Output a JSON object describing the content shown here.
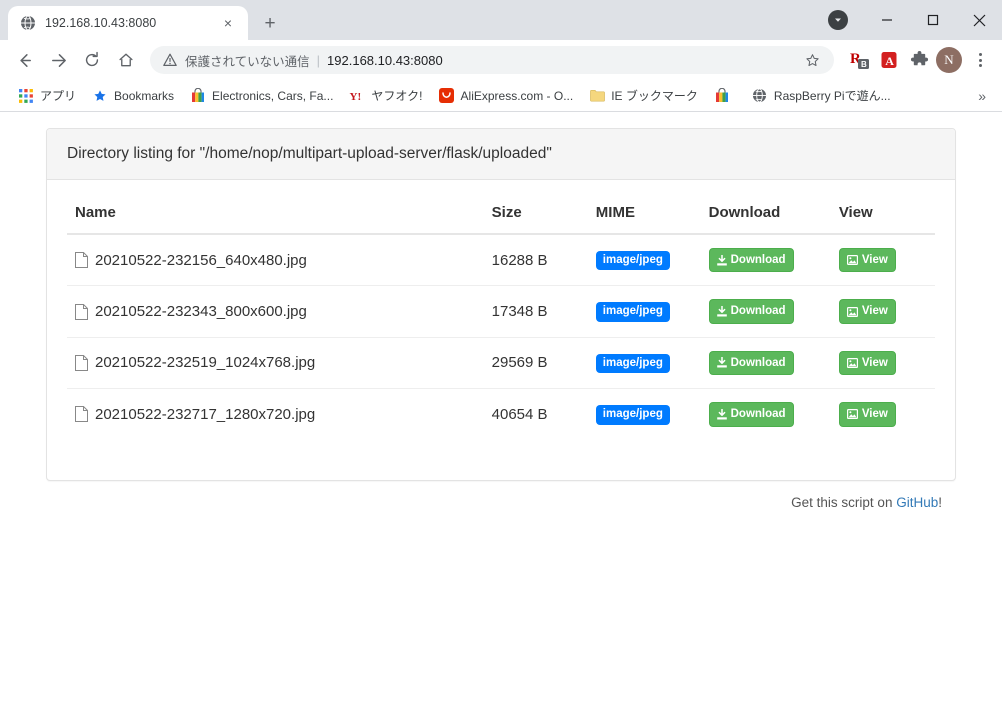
{
  "window": {
    "minimize_label": "Minimize",
    "maximize_label": "Maximize",
    "close_label": "Close",
    "download_indicator_name": "downloads-indicator"
  },
  "tab": {
    "title": "192.168.10.43:8080",
    "favicon_name": "globe-icon",
    "close_label": "×",
    "new_tab_label": "+"
  },
  "toolbar": {
    "back_label": "←",
    "forward_label": "→",
    "reload_label": "⟳",
    "home_label": "⌂",
    "security_text": "保護されていない通信",
    "separator": "|",
    "url": "192.168.10.43:8080",
    "bookmark_star_label": "☆",
    "extensions": [
      {
        "name": "rakuten-extension-icon",
        "label": "R",
        "badge": "B"
      },
      {
        "name": "adobe-acrobat-extension-icon",
        "label": "A"
      },
      {
        "name": "extensions-puzzle-icon",
        "label": "❖"
      }
    ],
    "profile_initial": "N",
    "menu_label": "⋮"
  },
  "bookmarks_bar": {
    "items": [
      {
        "label": "アプリ",
        "icon": "apps-grid-icon"
      },
      {
        "label": "Bookmarks",
        "icon": "star-icon"
      },
      {
        "label": "Electronics, Cars, Fa...",
        "icon": "shopping-bag-icon"
      },
      {
        "label": "ヤフオク!",
        "icon": "yahoo-icon"
      },
      {
        "label": "AliExpress.com - O...",
        "icon": "aliexpress-icon"
      },
      {
        "label": "IE ブックマーク",
        "icon": "folder-icon"
      },
      {
        "label": "",
        "icon": "shopping-bag-icon"
      },
      {
        "label": "RaspBerry Piで遊ん...",
        "icon": "globe-icon"
      }
    ],
    "overflow_label": "»"
  },
  "page": {
    "heading": "Directory listing for \"/home/nop/multipart-upload-server/flask/uploaded\"",
    "columns": [
      "Name",
      "Size",
      "MIME",
      "Download",
      "View"
    ],
    "rows": [
      {
        "name": "20210522-232156_640x480.jpg",
        "size": "16288 B",
        "mime": "image/jpeg",
        "download_label": "Download",
        "view_label": "View"
      },
      {
        "name": "20210522-232343_800x600.jpg",
        "size": "17348 B",
        "mime": "image/jpeg",
        "download_label": "Download",
        "view_label": "View"
      },
      {
        "name": "20210522-232519_1024x768.jpg",
        "size": "29569 B",
        "mime": "image/jpeg",
        "download_label": "Download",
        "view_label": "View"
      },
      {
        "name": "20210522-232717_1280x720.jpg",
        "size": "40654 B",
        "mime": "image/jpeg",
        "download_label": "Download",
        "view_label": "View"
      }
    ],
    "footer_prefix": "Get this script on ",
    "footer_link": "GitHub",
    "footer_suffix": "!"
  },
  "colors": {
    "mime_badge": "#007bff",
    "action_button": "#5cb85c",
    "link": "#337ab7",
    "card_header_bg": "#f5f5f5",
    "tabstrip_bg": "#dee1e6"
  }
}
